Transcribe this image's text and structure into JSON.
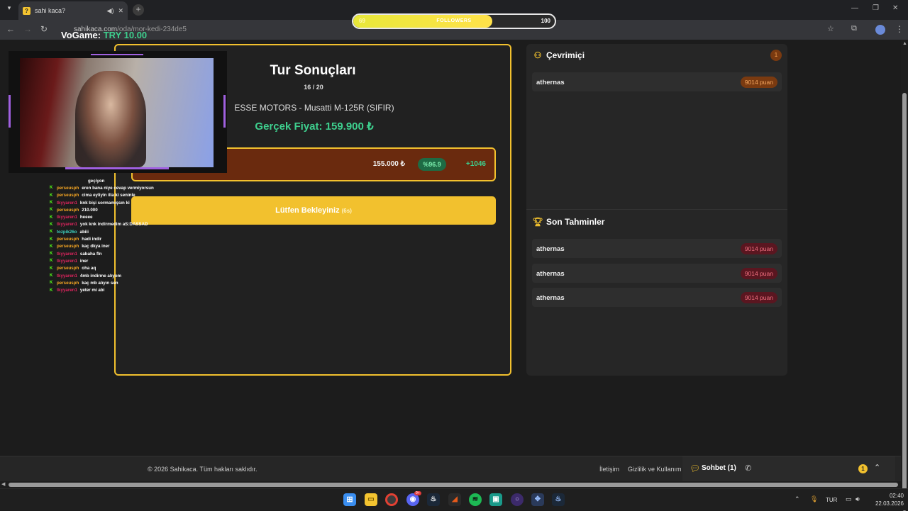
{
  "browser": {
    "tab_title": "sahi kaca?",
    "tab_favicon": "?",
    "url_site": "sahikaca.com",
    "url_path": "/oda/mor-kedi-234de5"
  },
  "overlay": {
    "followers_current": "69",
    "followers_label": "FOLLOWERS",
    "followers_max": "100",
    "followers_progress": 0.69,
    "vogame_label": "VoGame:",
    "vogame_amount": "TRY 10.00"
  },
  "game": {
    "title": "Tur Sonuçları",
    "round": "16 / 20",
    "product": "ESSE MOTORS - Musatti M-125R (SIFIR)",
    "real_price": "Gerçek Fiyat: 159.900 ₺",
    "guess_value": "155.000 ₺",
    "accuracy": "%96.9",
    "points": "+1046",
    "wait_label": "Lütfen Bekleyiniz",
    "wait_seconds": "(6s)"
  },
  "chat": [
    {
      "user": "",
      "msg": "geçiyon",
      "color": "#f5a623"
    },
    {
      "user": "perseusph",
      "msg": "eren bana niye cevap vermiyorsun",
      "color": "#f5a623"
    },
    {
      "user": "perseusph",
      "msg": "cima eyliyin illa ki seninle",
      "color": "#f5a623"
    },
    {
      "user": "tkyyaren1",
      "msg": "knk bişi sormamışsın ki",
      "color": "#e0245e"
    },
    {
      "user": "perseusph",
      "msg": "210.000",
      "color": "#f5a623"
    },
    {
      "user": "tkyyaren1",
      "msg": "heeee",
      "color": "#e0245e"
    },
    {
      "user": "tkyyaren1",
      "msg": "yok knk indirmedim aS:DASSAD",
      "color": "#e0245e"
    },
    {
      "user": "tozpik26o",
      "msg": "abiii",
      "color": "#3ecfbe"
    },
    {
      "user": "perseusph",
      "msg": "hadi indir",
      "color": "#f5a623"
    },
    {
      "user": "perseusph",
      "msg": "kaç dkya iner",
      "color": "#f5a623"
    },
    {
      "user": "tkyyaren1",
      "msg": "sabaha fln",
      "color": "#e0245e"
    },
    {
      "user": "tkyyaren1",
      "msg": "iner",
      "color": "#e0245e"
    },
    {
      "user": "perseusph",
      "msg": "oha aq",
      "color": "#f5a623"
    },
    {
      "user": "tkyyaren1",
      "msg": "4mb indirme alıyom",
      "color": "#e0245e"
    },
    {
      "user": "perseusph",
      "msg": "kaç mb alıyın sen",
      "color": "#f5a623"
    },
    {
      "user": "tkyyaren1",
      "msg": "yeter mi abi",
      "color": "#e0245e"
    }
  ],
  "online": {
    "title": "Çevrimiçi",
    "count": "1",
    "players": [
      {
        "name": "athernas",
        "score": "9014 puan"
      }
    ]
  },
  "recent": {
    "title": "Son Tahminler",
    "entries": [
      {
        "name": "athernas",
        "score": "9014 puan"
      },
      {
        "name": "athernas",
        "score": "9014 puan"
      },
      {
        "name": "athernas",
        "score": "9014 puan"
      }
    ]
  },
  "footer": {
    "copyright": "© 2026 Sahikaca. Tüm hakları saklıdır.",
    "contact": "İletişim",
    "privacy": "Gizlilik ve Kullanım",
    "chat_label": "Sohbet (1)",
    "notif_count": "1"
  },
  "taskbar": {
    "lang": "TUR",
    "time": "02:40",
    "date": "22.03.2026",
    "discord_badge": "9+"
  },
  "colors": {
    "accent": "#f2c12e",
    "success": "#3ecf8e",
    "result_bg": "#6a2a0e"
  }
}
